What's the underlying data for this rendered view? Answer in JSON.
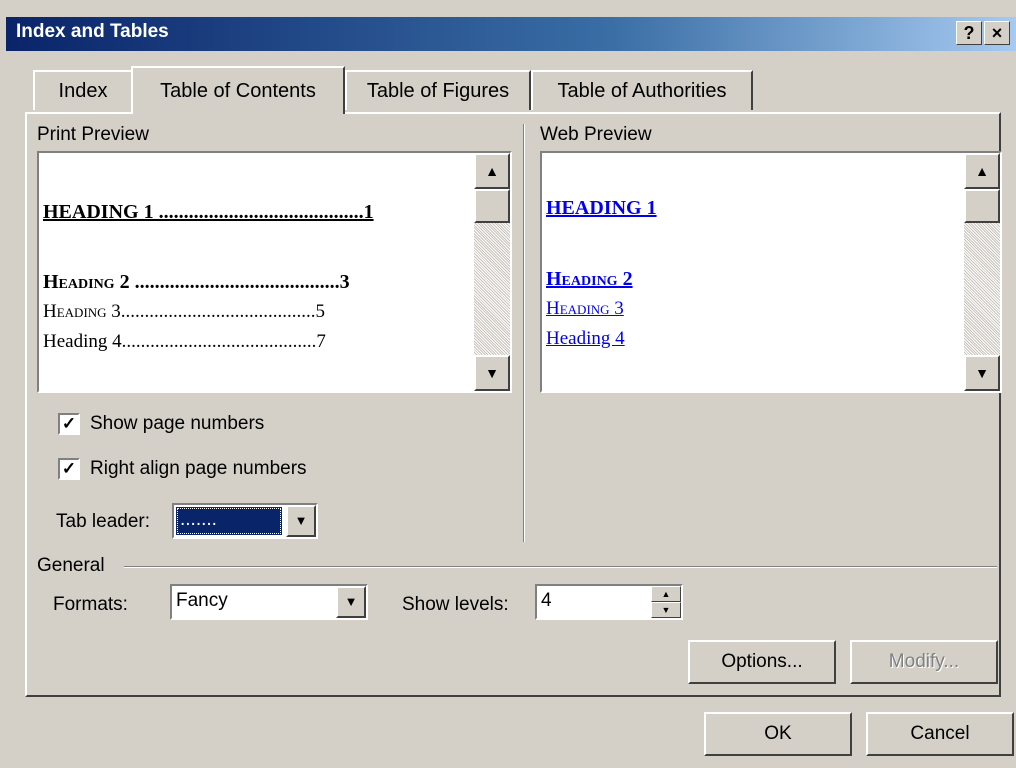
{
  "window": {
    "title": "Index and Tables",
    "help_label": "?",
    "close_label": "×"
  },
  "tabs": [
    {
      "label": "Index",
      "active": false
    },
    {
      "label": "Table of Contents",
      "active": true
    },
    {
      "label": "Table of Figures",
      "active": false
    },
    {
      "label": "Table of Authorities",
      "active": false
    }
  ],
  "print_preview": {
    "label": "Print Preview",
    "entries": [
      {
        "text": "HEADING 1 .........................................1"
      },
      {
        "text": "Heading 2 .........................................3"
      },
      {
        "text": "Heading 3.........................................5"
      },
      {
        "text": "Heading 4.........................................7"
      }
    ]
  },
  "web_preview": {
    "label": "Web Preview",
    "entries": [
      {
        "text": "HEADING 1"
      },
      {
        "text": "Heading 2"
      },
      {
        "text": "Heading 3"
      },
      {
        "text": "Heading 4"
      }
    ]
  },
  "options": {
    "show_page_numbers": {
      "label": "Show page numbers",
      "checked": true,
      "mark": "✓"
    },
    "right_align": {
      "label": "Right align page numbers",
      "checked": true,
      "mark": "✓"
    },
    "tab_leader": {
      "label": "Tab leader:",
      "value": "......."
    }
  },
  "general": {
    "label": "General",
    "formats_label": "Formats:",
    "formats_value": "Fancy",
    "show_levels_label": "Show levels:",
    "show_levels_value": "4"
  },
  "buttons": {
    "options": "Options...",
    "modify": "Modify...",
    "ok": "OK",
    "cancel": "Cancel"
  },
  "glyphs": {
    "up": "▲",
    "down": "▼",
    "spin_up": "▲",
    "spin_down": "▼"
  },
  "colors": {
    "face": "#d4d0c8",
    "title_start": "#0a246a",
    "title_end": "#a6caf0",
    "link": "#0000ee",
    "selection": "#0a246a"
  }
}
